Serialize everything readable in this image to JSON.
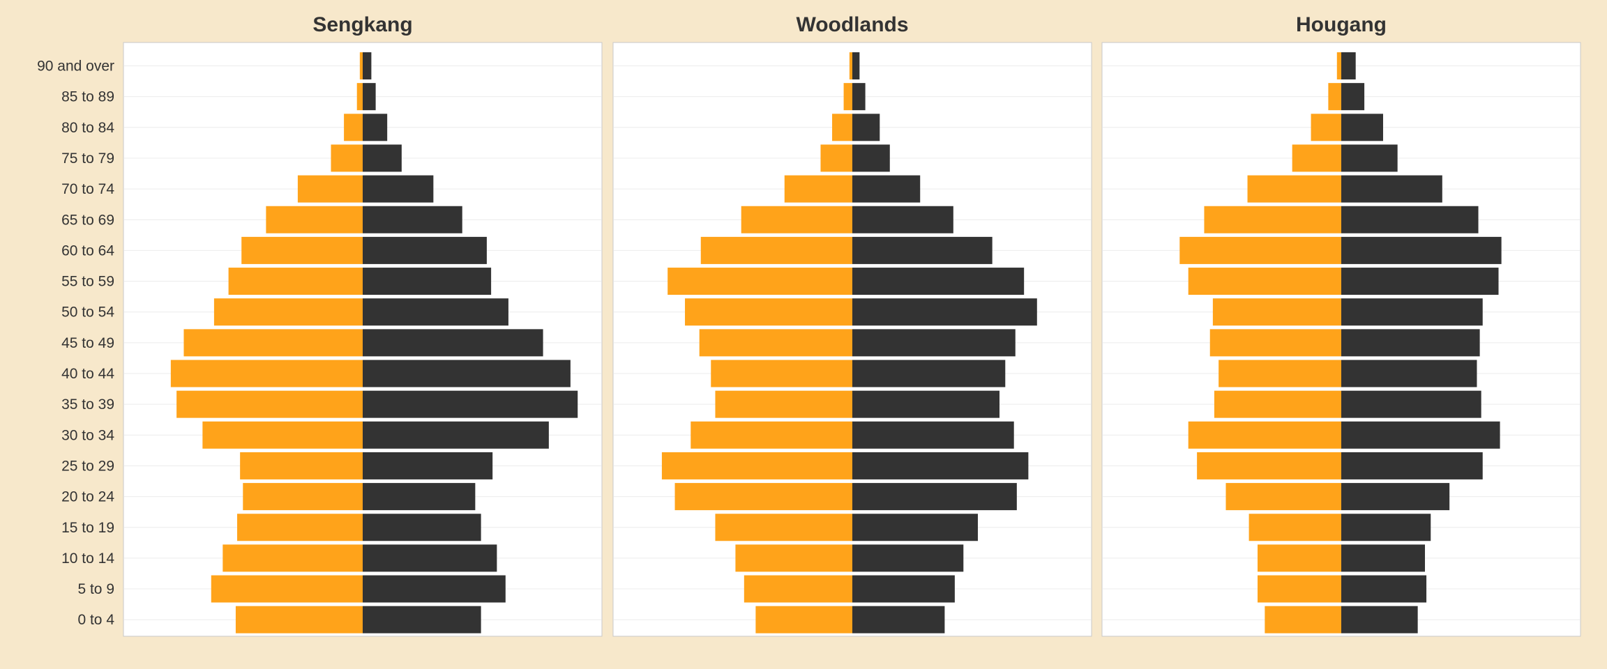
{
  "chart_data": {
    "type": "bar",
    "subtype": "population-pyramid",
    "categories": [
      "0 to 4",
      "5 to 9",
      "10 to 14",
      "15 to 19",
      "20 to 24",
      "25 to 29",
      "30 to 34",
      "35 to 39",
      "40 to 44",
      "45 to 49",
      "50 to 54",
      "55 to 59",
      "60 to 64",
      "65 to 69",
      "70 to 74",
      "75 to 79",
      "80 to 84",
      "85 to 89",
      "90 and over"
    ],
    "colors": {
      "left": "#ffa31a",
      "right": "#333333",
      "panel_bg": "#ffffff",
      "figure_bg": "#f7e8cb"
    },
    "grid": true,
    "xlim": [
      -16000,
      16000
    ],
    "panels": [
      {
        "title": "Sengkang",
        "series": [
          {
            "side": "left",
            "values": [
              8800,
              10500,
              9700,
              8700,
              8300,
              8500,
              11100,
              12900,
              13300,
              12400,
              10300,
              9300,
              8400,
              6700,
              4500,
              2200,
              1300,
              400,
              200
            ]
          },
          {
            "side": "right",
            "values": [
              8200,
              9900,
              9300,
              8200,
              7800,
              9000,
              12900,
              14900,
              14400,
              12500,
              10100,
              8900,
              8600,
              6900,
              4900,
              2700,
              1700,
              900,
              600
            ]
          }
        ]
      },
      {
        "title": "Woodlands",
        "series": [
          {
            "side": "left",
            "values": [
              6700,
              7500,
              8100,
              9500,
              12300,
              13200,
              11200,
              9500,
              9800,
              10600,
              11600,
              12800,
              10500,
              7700,
              4700,
              2200,
              1400,
              600,
              200
            ]
          },
          {
            "side": "right",
            "values": [
              6400,
              7100,
              7700,
              8700,
              11400,
              12200,
              11200,
              10200,
              10600,
              11300,
              12800,
              11900,
              9700,
              7000,
              4700,
              2600,
              1900,
              900,
              500
            ]
          }
        ]
      },
      {
        "title": "Hougang",
        "series": [
          {
            "side": "left",
            "values": [
              5300,
              5800,
              5800,
              6400,
              8000,
              10000,
              10600,
              8800,
              8500,
              9100,
              8900,
              10600,
              11200,
              9500,
              6500,
              3400,
              2100,
              900,
              300
            ]
          },
          {
            "side": "right",
            "values": [
              5300,
              5900,
              5800,
              6200,
              7500,
              9800,
              11000,
              9700,
              9400,
              9600,
              9800,
              10900,
              11100,
              9500,
              7000,
              3900,
              2900,
              1600,
              1000
            ]
          }
        ]
      }
    ]
  }
}
